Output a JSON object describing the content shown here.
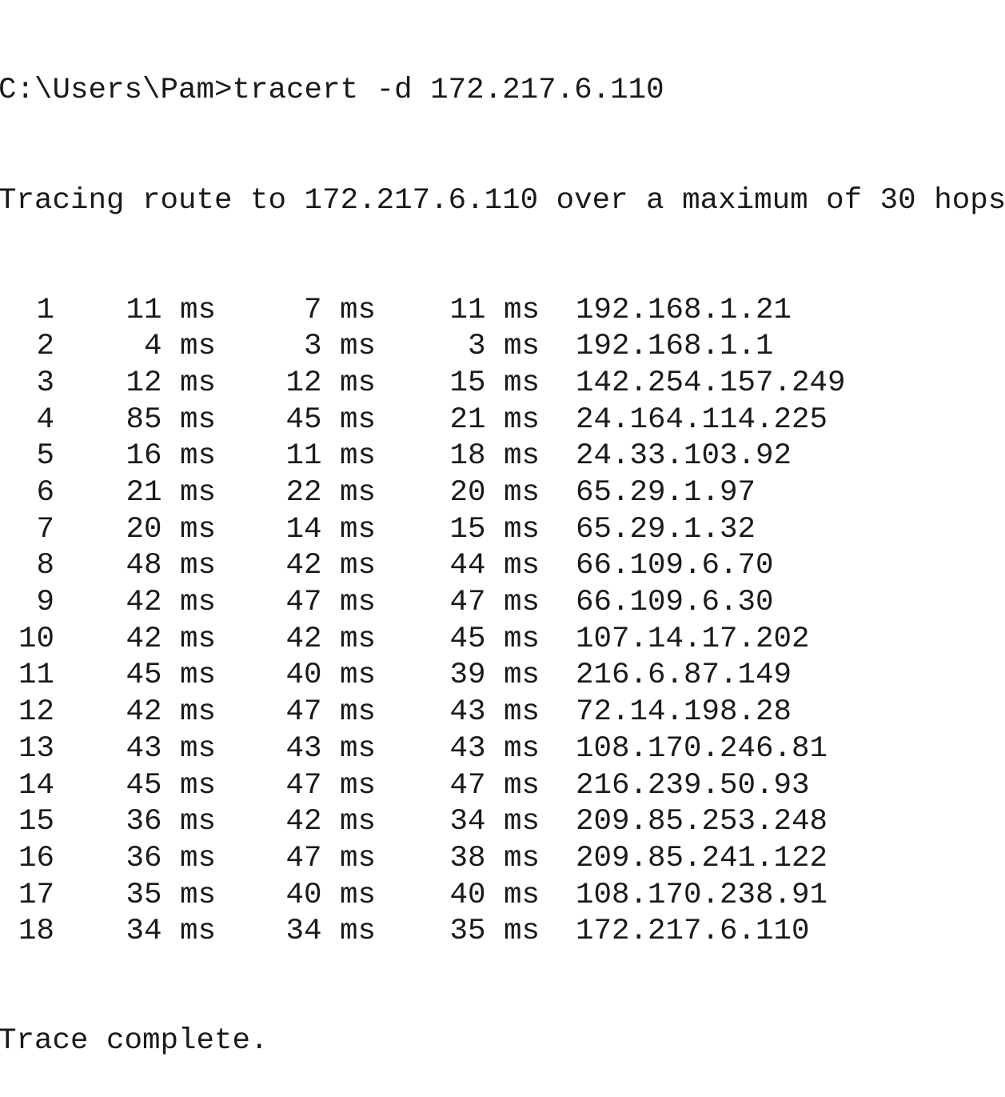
{
  "terminal": {
    "command_line": "C:\\Users\\Pam>tracert -d 172.217.6.110",
    "header_line": "Tracing route to 172.217.6.110 over a maximum of 30 hops",
    "footer_line": "Trace complete.",
    "hops": [
      {
        "hop": "1",
        "t1": "11 ms",
        "t2": "7 ms",
        "t3": "11 ms",
        "ip": "192.168.1.21"
      },
      {
        "hop": "2",
        "t1": "4 ms",
        "t2": "3 ms",
        "t3": "3 ms",
        "ip": "192.168.1.1"
      },
      {
        "hop": "3",
        "t1": "12 ms",
        "t2": "12 ms",
        "t3": "15 ms",
        "ip": "142.254.157.249"
      },
      {
        "hop": "4",
        "t1": "85 ms",
        "t2": "45 ms",
        "t3": "21 ms",
        "ip": "24.164.114.225"
      },
      {
        "hop": "5",
        "t1": "16 ms",
        "t2": "11 ms",
        "t3": "18 ms",
        "ip": "24.33.103.92"
      },
      {
        "hop": "6",
        "t1": "21 ms",
        "t2": "22 ms",
        "t3": "20 ms",
        "ip": "65.29.1.97"
      },
      {
        "hop": "7",
        "t1": "20 ms",
        "t2": "14 ms",
        "t3": "15 ms",
        "ip": "65.29.1.32"
      },
      {
        "hop": "8",
        "t1": "48 ms",
        "t2": "42 ms",
        "t3": "44 ms",
        "ip": "66.109.6.70"
      },
      {
        "hop": "9",
        "t1": "42 ms",
        "t2": "47 ms",
        "t3": "47 ms",
        "ip": "66.109.6.30"
      },
      {
        "hop": "10",
        "t1": "42 ms",
        "t2": "42 ms",
        "t3": "45 ms",
        "ip": "107.14.17.202"
      },
      {
        "hop": "11",
        "t1": "45 ms",
        "t2": "40 ms",
        "t3": "39 ms",
        "ip": "216.6.87.149"
      },
      {
        "hop": "12",
        "t1": "42 ms",
        "t2": "47 ms",
        "t3": "43 ms",
        "ip": "72.14.198.28"
      },
      {
        "hop": "13",
        "t1": "43 ms",
        "t2": "43 ms",
        "t3": "43 ms",
        "ip": "108.170.246.81"
      },
      {
        "hop": "14",
        "t1": "45 ms",
        "t2": "47 ms",
        "t3": "47 ms",
        "ip": "216.239.50.93"
      },
      {
        "hop": "15",
        "t1": "36 ms",
        "t2": "42 ms",
        "t3": "34 ms",
        "ip": "209.85.253.248"
      },
      {
        "hop": "16",
        "t1": "36 ms",
        "t2": "47 ms",
        "t3": "38 ms",
        "ip": "209.85.241.122"
      },
      {
        "hop": "17",
        "t1": "35 ms",
        "t2": "40 ms",
        "t3": "40 ms",
        "ip": "108.170.238.91"
      },
      {
        "hop": "18",
        "t1": "34 ms",
        "t2": "34 ms",
        "t3": "35 ms",
        "ip": "172.217.6.110"
      }
    ]
  }
}
